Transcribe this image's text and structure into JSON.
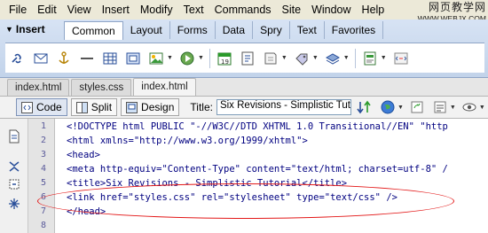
{
  "menubar": {
    "items": [
      "File",
      "Edit",
      "View",
      "Insert",
      "Modify",
      "Text",
      "Commands",
      "Site",
      "Window",
      "Help"
    ]
  },
  "watermark": {
    "line1": "网页教学网",
    "line2": "WWW.WEBJX.COM"
  },
  "insert_panel": {
    "title": "Insert",
    "tabs": [
      "Common",
      "Layout",
      "Forms",
      "Data",
      "Spry",
      "Text",
      "Favorites"
    ],
    "active_tab": "Common"
  },
  "doc_tabs": [
    "index.html",
    "styles.css",
    "index.html"
  ],
  "doc_toolbar": {
    "code_label": "Code",
    "split_label": "Split",
    "design_label": "Design",
    "title_label": "Title:",
    "title_value": "Six Revisions - Simplistic Tutori"
  },
  "code": {
    "line_numbers": [
      "1",
      "2",
      "3",
      "4",
      "5",
      "6",
      "7",
      "8"
    ],
    "lines": [
      "<!DOCTYPE html PUBLIC \"-//W3C//DTD XHTML 1.0 Transitional//EN\" \"http",
      "<html xmlns=\"http://www.w3.org/1999/xhtml\">",
      "<head>",
      "<meta http-equiv=\"Content-Type\" content=\"text/html; charset=utf-8\" /",
      "<title>Six Revisions - Simplistic Tutorial</title>",
      "<link href=\"styles.css\" rel=\"stylesheet\" type=\"text/css\" />",
      "</head>",
      ""
    ]
  },
  "colors": {
    "code_tag": "#000080",
    "highlight_oval": "#e31818",
    "insert_panel_bg": "#c8d8ee"
  }
}
